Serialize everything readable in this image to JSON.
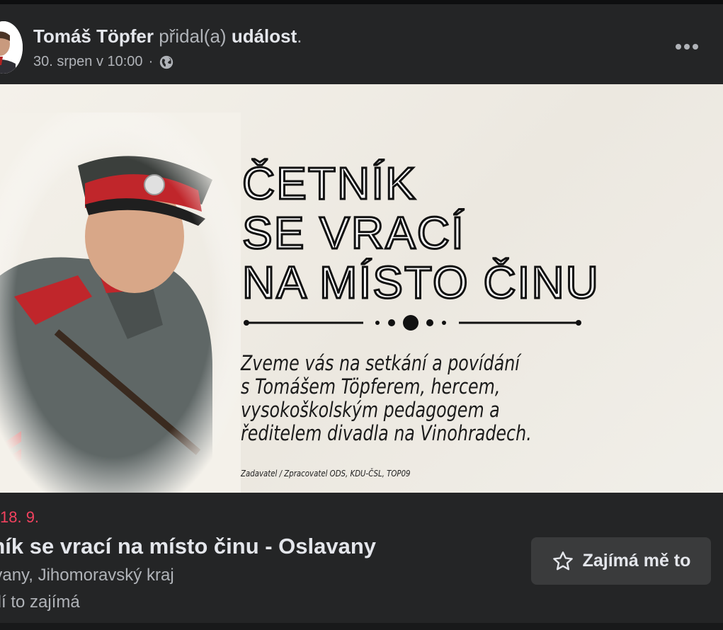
{
  "post": {
    "author": "Tomáš Töpfer",
    "action_verb": "přidal(a)",
    "action_object": "událost",
    "action_suffix": ".",
    "timestamp": "30. srpen v 10:00",
    "separator": "·",
    "privacy_icon": "globe-icon",
    "more_icon": "more-options-icon"
  },
  "banner": {
    "title_lines": [
      "ČETNÍK",
      "SE VRACÍ",
      "NA MÍSTO ČINU"
    ],
    "invite_lines": [
      "Zveme vás na setkání a povídání",
      "s Tomášem Töpferem, hercem,",
      "vysokoškolským pedagogem a",
      "ředitelem divadla na Vinohradech."
    ],
    "sponsor": "Zadavatel / Zpracovatel ODS, KDU-ČSL, TOP09"
  },
  "event": {
    "date": "18. 9.",
    "title": "tník se vrací na místo činu - Oslavany",
    "location": "avany, Jihomoravský kraj",
    "interest_count": "lidí to zajímá",
    "interest_button": "Zajímá mě to",
    "interest_icon": "star-outline-icon"
  },
  "colors": {
    "background": "#242526",
    "text_primary": "#e4e6eb",
    "text_secondary": "#b0b3b8",
    "date_accent": "#f3425f",
    "button_bg": "#3a3b3c"
  }
}
